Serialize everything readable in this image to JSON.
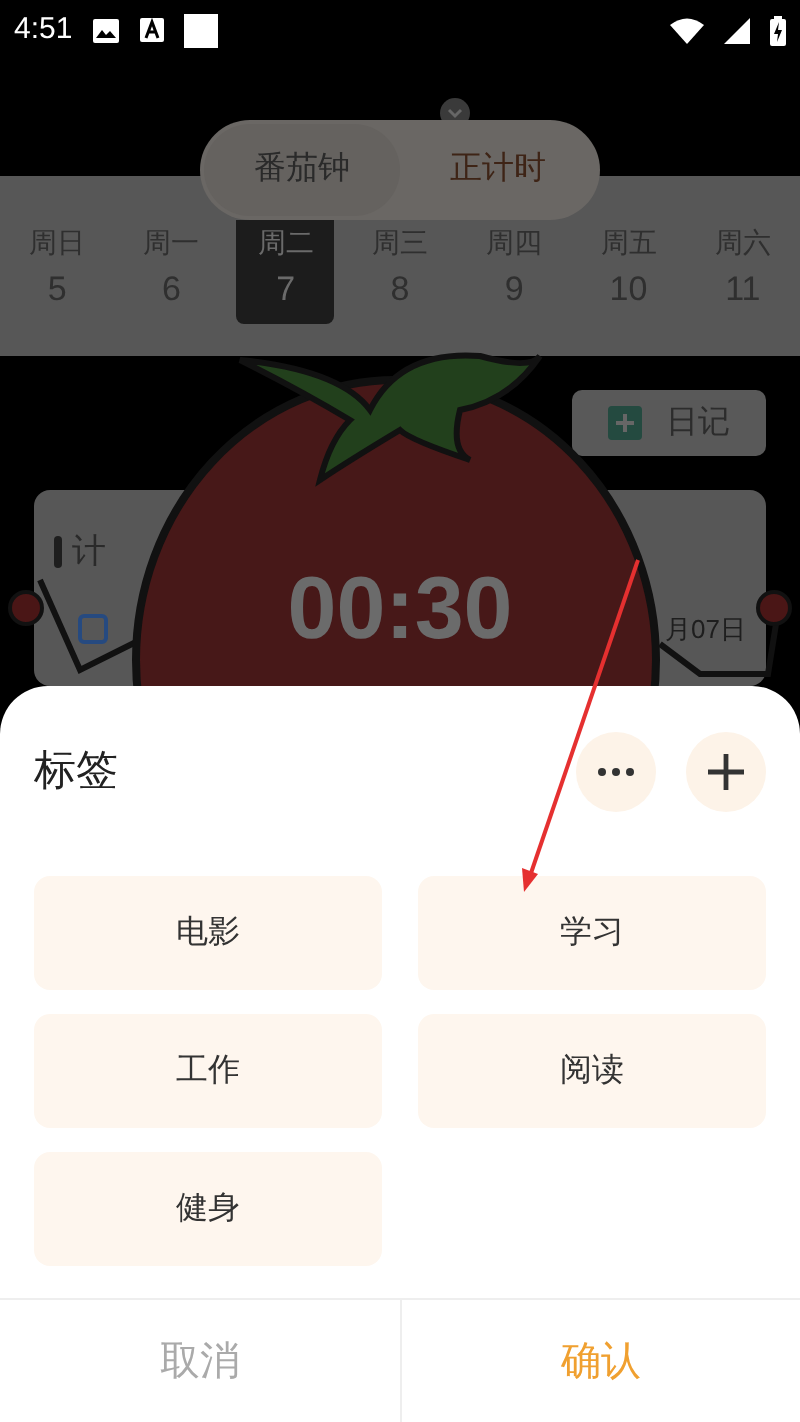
{
  "status_bar": {
    "time": "4:51"
  },
  "mode_switch": [
    {
      "label": "番茄钟",
      "selected": true
    },
    {
      "label": "正计时",
      "selected": false
    }
  ],
  "week": [
    {
      "weekday": "周日",
      "day": "5",
      "selected": false
    },
    {
      "weekday": "周一",
      "day": "6",
      "selected": false
    },
    {
      "weekday": "周二",
      "day": "7",
      "selected": true
    },
    {
      "weekday": "周三",
      "day": "8",
      "selected": false
    },
    {
      "weekday": "周四",
      "day": "9",
      "selected": false
    },
    {
      "weekday": "周五",
      "day": "10",
      "selected": false
    },
    {
      "weekday": "周六",
      "day": "11",
      "selected": false
    }
  ],
  "diary_button": "日记",
  "plan_card": {
    "title": "计",
    "date": "月07日",
    "checked": false
  },
  "timer": "00:30",
  "sheet": {
    "title": "标签",
    "tags": [
      "电影",
      "学习",
      "工作",
      "阅读",
      "健身"
    ],
    "cancel": "取消",
    "confirm": "确认"
  }
}
